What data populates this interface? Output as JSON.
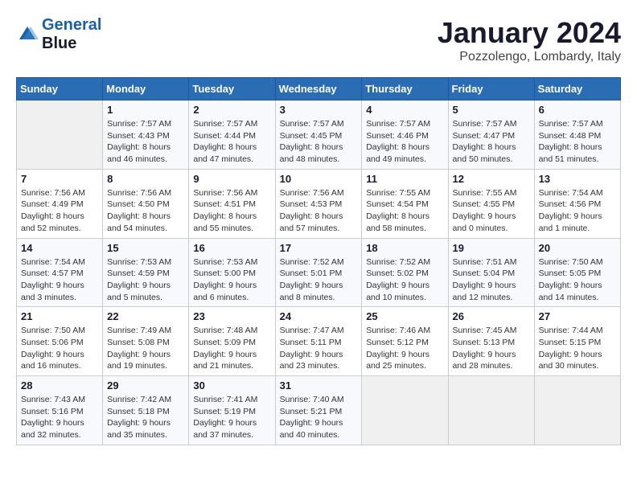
{
  "header": {
    "logo_line1": "General",
    "logo_line2": "Blue",
    "month_title": "January 2024",
    "location": "Pozzolengo, Lombardy, Italy"
  },
  "days_of_week": [
    "Sunday",
    "Monday",
    "Tuesday",
    "Wednesday",
    "Thursday",
    "Friday",
    "Saturday"
  ],
  "weeks": [
    [
      {
        "day": "",
        "info": ""
      },
      {
        "day": "1",
        "info": "Sunrise: 7:57 AM\nSunset: 4:43 PM\nDaylight: 8 hours\nand 46 minutes."
      },
      {
        "day": "2",
        "info": "Sunrise: 7:57 AM\nSunset: 4:44 PM\nDaylight: 8 hours\nand 47 minutes."
      },
      {
        "day": "3",
        "info": "Sunrise: 7:57 AM\nSunset: 4:45 PM\nDaylight: 8 hours\nand 48 minutes."
      },
      {
        "day": "4",
        "info": "Sunrise: 7:57 AM\nSunset: 4:46 PM\nDaylight: 8 hours\nand 49 minutes."
      },
      {
        "day": "5",
        "info": "Sunrise: 7:57 AM\nSunset: 4:47 PM\nDaylight: 8 hours\nand 50 minutes."
      },
      {
        "day": "6",
        "info": "Sunrise: 7:57 AM\nSunset: 4:48 PM\nDaylight: 8 hours\nand 51 minutes."
      }
    ],
    [
      {
        "day": "7",
        "info": "Sunrise: 7:56 AM\nSunset: 4:49 PM\nDaylight: 8 hours\nand 52 minutes."
      },
      {
        "day": "8",
        "info": "Sunrise: 7:56 AM\nSunset: 4:50 PM\nDaylight: 8 hours\nand 54 minutes."
      },
      {
        "day": "9",
        "info": "Sunrise: 7:56 AM\nSunset: 4:51 PM\nDaylight: 8 hours\nand 55 minutes."
      },
      {
        "day": "10",
        "info": "Sunrise: 7:56 AM\nSunset: 4:53 PM\nDaylight: 8 hours\nand 57 minutes."
      },
      {
        "day": "11",
        "info": "Sunrise: 7:55 AM\nSunset: 4:54 PM\nDaylight: 8 hours\nand 58 minutes."
      },
      {
        "day": "12",
        "info": "Sunrise: 7:55 AM\nSunset: 4:55 PM\nDaylight: 9 hours\nand 0 minutes."
      },
      {
        "day": "13",
        "info": "Sunrise: 7:54 AM\nSunset: 4:56 PM\nDaylight: 9 hours\nand 1 minute."
      }
    ],
    [
      {
        "day": "14",
        "info": "Sunrise: 7:54 AM\nSunset: 4:57 PM\nDaylight: 9 hours\nand 3 minutes."
      },
      {
        "day": "15",
        "info": "Sunrise: 7:53 AM\nSunset: 4:59 PM\nDaylight: 9 hours\nand 5 minutes."
      },
      {
        "day": "16",
        "info": "Sunrise: 7:53 AM\nSunset: 5:00 PM\nDaylight: 9 hours\nand 6 minutes."
      },
      {
        "day": "17",
        "info": "Sunrise: 7:52 AM\nSunset: 5:01 PM\nDaylight: 9 hours\nand 8 minutes."
      },
      {
        "day": "18",
        "info": "Sunrise: 7:52 AM\nSunset: 5:02 PM\nDaylight: 9 hours\nand 10 minutes."
      },
      {
        "day": "19",
        "info": "Sunrise: 7:51 AM\nSunset: 5:04 PM\nDaylight: 9 hours\nand 12 minutes."
      },
      {
        "day": "20",
        "info": "Sunrise: 7:50 AM\nSunset: 5:05 PM\nDaylight: 9 hours\nand 14 minutes."
      }
    ],
    [
      {
        "day": "21",
        "info": "Sunrise: 7:50 AM\nSunset: 5:06 PM\nDaylight: 9 hours\nand 16 minutes."
      },
      {
        "day": "22",
        "info": "Sunrise: 7:49 AM\nSunset: 5:08 PM\nDaylight: 9 hours\nand 19 minutes."
      },
      {
        "day": "23",
        "info": "Sunrise: 7:48 AM\nSunset: 5:09 PM\nDaylight: 9 hours\nand 21 minutes."
      },
      {
        "day": "24",
        "info": "Sunrise: 7:47 AM\nSunset: 5:11 PM\nDaylight: 9 hours\nand 23 minutes."
      },
      {
        "day": "25",
        "info": "Sunrise: 7:46 AM\nSunset: 5:12 PM\nDaylight: 9 hours\nand 25 minutes."
      },
      {
        "day": "26",
        "info": "Sunrise: 7:45 AM\nSunset: 5:13 PM\nDaylight: 9 hours\nand 28 minutes."
      },
      {
        "day": "27",
        "info": "Sunrise: 7:44 AM\nSunset: 5:15 PM\nDaylight: 9 hours\nand 30 minutes."
      }
    ],
    [
      {
        "day": "28",
        "info": "Sunrise: 7:43 AM\nSunset: 5:16 PM\nDaylight: 9 hours\nand 32 minutes."
      },
      {
        "day": "29",
        "info": "Sunrise: 7:42 AM\nSunset: 5:18 PM\nDaylight: 9 hours\nand 35 minutes."
      },
      {
        "day": "30",
        "info": "Sunrise: 7:41 AM\nSunset: 5:19 PM\nDaylight: 9 hours\nand 37 minutes."
      },
      {
        "day": "31",
        "info": "Sunrise: 7:40 AM\nSunset: 5:21 PM\nDaylight: 9 hours\nand 40 minutes."
      },
      {
        "day": "",
        "info": ""
      },
      {
        "day": "",
        "info": ""
      },
      {
        "day": "",
        "info": ""
      }
    ]
  ]
}
